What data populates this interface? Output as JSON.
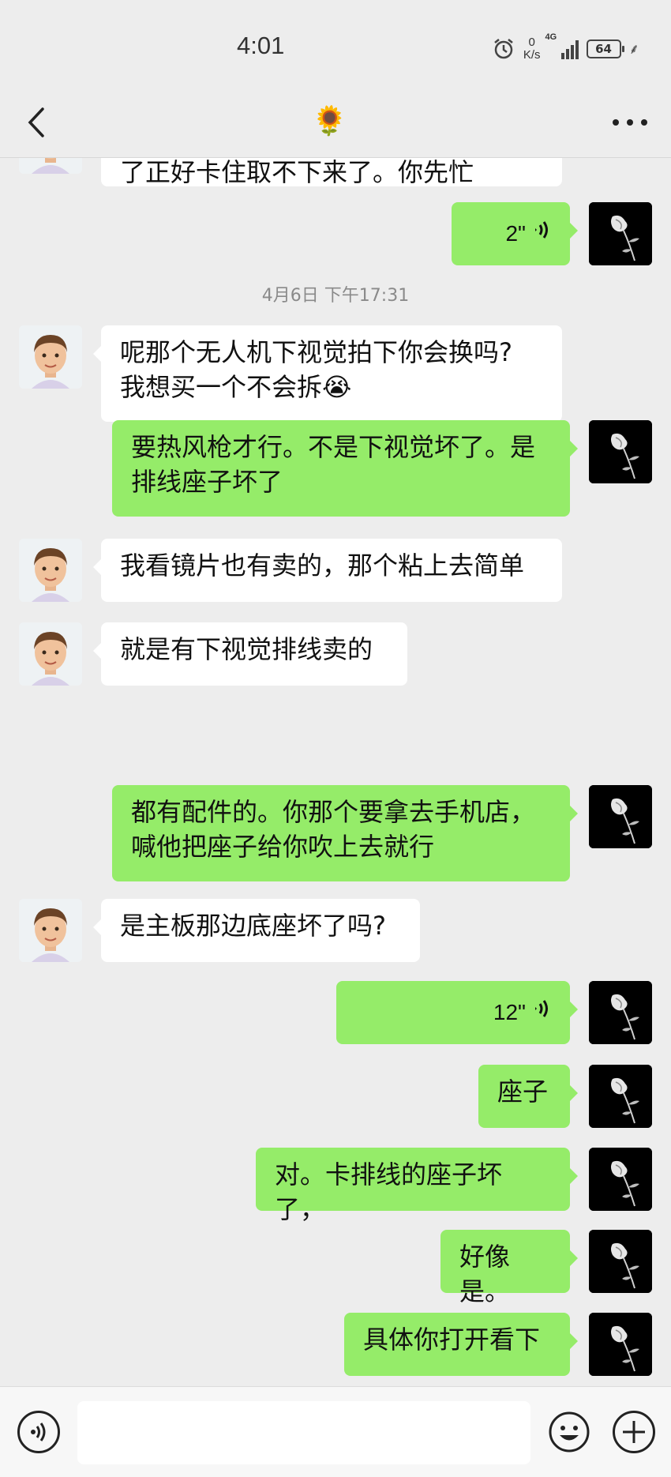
{
  "status_bar": {
    "time": "4:01",
    "net_speed_value": "0",
    "net_speed_unit": "K/s",
    "network": "4G",
    "battery": "64"
  },
  "nav": {
    "title": "🌻"
  },
  "messages": [
    {
      "side": "left",
      "type": "text",
      "text": "恳，正常装上去很好取下来的，装反\n了正好卡住取不下来了。你先忙"
    },
    {
      "side": "right",
      "type": "voice",
      "duration": "2\""
    },
    {
      "side": "center",
      "type": "time",
      "text": "4月6日 下午17:31"
    },
    {
      "side": "left",
      "type": "text",
      "text": "呢那个无人机下视觉拍下你会换吗?\n我想买一个不会拆😭"
    },
    {
      "side": "right",
      "type": "text",
      "text": "要热风枪才行。不是下视觉坏了。是\n排线座子坏了"
    },
    {
      "side": "left",
      "type": "text",
      "text": "我看镜片也有卖的，那个粘上去简单"
    },
    {
      "side": "left",
      "type": "text",
      "text": "就是有下视觉排线卖的"
    },
    {
      "side": "right",
      "type": "text",
      "text": "都有配件的。你那个要拿去手机店，\n喊他把座子给你吹上去就行"
    },
    {
      "side": "left",
      "type": "text",
      "text": "是主板那边底座坏了吗?"
    },
    {
      "side": "right",
      "type": "voice",
      "duration": "12\""
    },
    {
      "side": "right",
      "type": "text",
      "text": "座子"
    },
    {
      "side": "right",
      "type": "text",
      "text": "对。卡排线的座子坏了，"
    },
    {
      "side": "right",
      "type": "text",
      "text": "好像是。"
    },
    {
      "side": "right",
      "type": "text",
      "text": "具体你打开看下"
    }
  ],
  "input_bar": {
    "placeholder": ""
  },
  "icons": {
    "back": "chevron-left-icon",
    "more": "more-dots-icon",
    "voice_toggle": "voice-wave-icon",
    "emoji": "smiley-icon",
    "plus": "plus-circle-icon"
  },
  "colors": {
    "background": "#ededed",
    "bubble_self": "#95ec69",
    "bubble_other": "#ffffff"
  }
}
